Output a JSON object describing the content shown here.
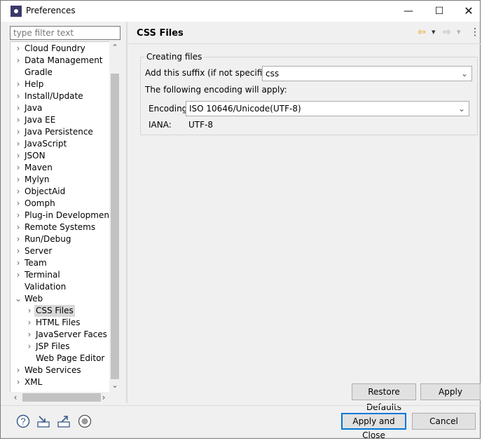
{
  "window": {
    "title": "Preferences",
    "min": "—",
    "max": "☐",
    "close": "✕"
  },
  "filter": {
    "placeholder": "type filter text"
  },
  "tree": {
    "items": [
      {
        "label": "Cloud Foundry",
        "chev": "›"
      },
      {
        "label": "Data Management",
        "chev": "›"
      },
      {
        "label": "Gradle",
        "chev": ""
      },
      {
        "label": "Help",
        "chev": "›"
      },
      {
        "label": "Install/Update",
        "chev": "›"
      },
      {
        "label": "Java",
        "chev": "›"
      },
      {
        "label": "Java EE",
        "chev": "›"
      },
      {
        "label": "Java Persistence",
        "chev": "›"
      },
      {
        "label": "JavaScript",
        "chev": "›"
      },
      {
        "label": "JSON",
        "chev": "›"
      },
      {
        "label": "Maven",
        "chev": "›"
      },
      {
        "label": "Mylyn",
        "chev": "›"
      },
      {
        "label": "ObjectAid",
        "chev": "›"
      },
      {
        "label": "Oomph",
        "chev": "›"
      },
      {
        "label": "Plug-in Development",
        "chev": "›"
      },
      {
        "label": "Remote Systems",
        "chev": "›"
      },
      {
        "label": "Run/Debug",
        "chev": "›"
      },
      {
        "label": "Server",
        "chev": "›"
      },
      {
        "label": "Team",
        "chev": "›"
      },
      {
        "label": "Terminal",
        "chev": "›"
      },
      {
        "label": "Validation",
        "chev": ""
      },
      {
        "label": "Web",
        "chev": "⌄"
      },
      {
        "label": "CSS Files",
        "chev": "›"
      },
      {
        "label": "HTML Files",
        "chev": "›"
      },
      {
        "label": "JavaServer Faces Too",
        "chev": "›"
      },
      {
        "label": "JSP Files",
        "chev": "›"
      },
      {
        "label": "Web Page Editor",
        "chev": ""
      },
      {
        "label": "Web Services",
        "chev": "›"
      },
      {
        "label": "XML",
        "chev": "›"
      }
    ]
  },
  "page": {
    "title": "CSS Files",
    "group_title": "Creating files",
    "suffix_label": "Add this suffix (if not specified):",
    "suffix_value": "css",
    "encoding_note": "The following encoding will apply:",
    "encoding_label": "Encoding:",
    "encoding_value": "ISO 10646/Unicode(UTF-8)",
    "iana_label": "IANA:",
    "iana_value": "UTF-8",
    "restore_defaults": "Restore Defaults",
    "apply": "Apply"
  },
  "nav": {
    "back": "⇦",
    "forward": "⇨",
    "menu": "⋮",
    "dropdown": "▾"
  },
  "footer": {
    "help_icon": "?",
    "apply_and_close": "Apply and Close",
    "cancel": "Cancel"
  },
  "colors": {
    "accent": "#0078d7",
    "selection": "#d9d9d9",
    "back_arrow": "#e8a317"
  }
}
